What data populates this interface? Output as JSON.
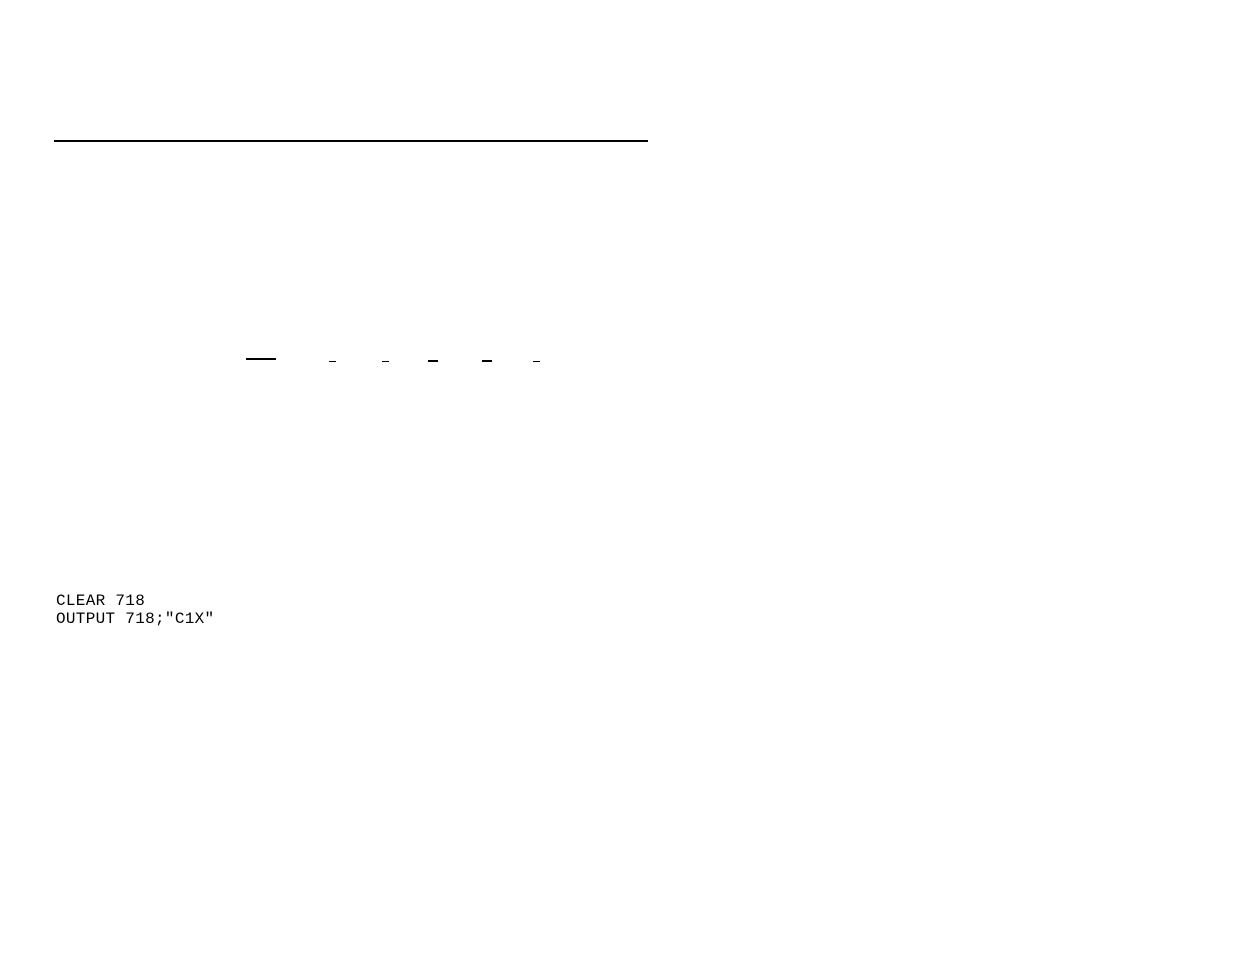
{
  "code": {
    "line1": "CLEAR 718",
    "line2": "OUTPUT 718;\"C1X\""
  }
}
